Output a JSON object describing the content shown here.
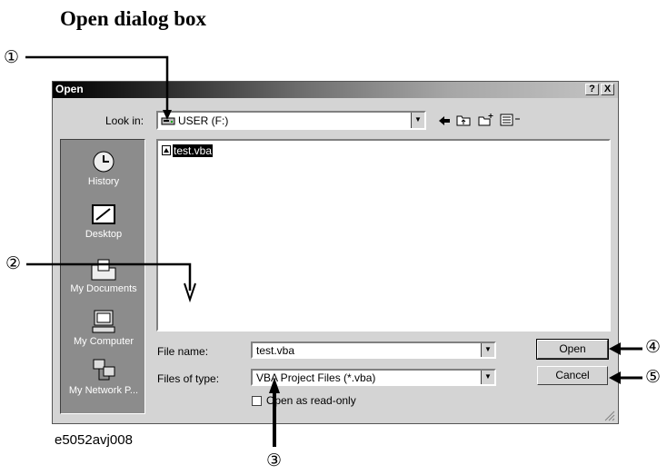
{
  "heading": "Open dialog box",
  "figure_id": "e5052avj008",
  "dialog": {
    "title": "Open",
    "title_buttons": {
      "help": "?",
      "close": "X"
    },
    "look_in_label": "Look in:",
    "look_in_value": "USER (F:)",
    "places": [
      {
        "label": "History",
        "icon": "history-icon"
      },
      {
        "label": "Desktop",
        "icon": "desktop-icon"
      },
      {
        "label": "My Documents",
        "icon": "documents-icon"
      },
      {
        "label": "My Computer",
        "icon": "computer-icon"
      },
      {
        "label": "My Network P...",
        "icon": "network-icon"
      }
    ],
    "files": [
      {
        "name": "test.vba",
        "icon": "file-icon",
        "selected": true
      }
    ],
    "file_name_label": "File name:",
    "file_name_value": "test.vba",
    "file_type_label": "Files of type:",
    "file_type_value": "VBA Project Files (*.vba)",
    "readonly_label": "Open as read-only",
    "readonly_checked": false,
    "open_label": "Open",
    "cancel_label": "Cancel",
    "toolbar_icons": [
      "back-icon",
      "up-folder-icon",
      "new-folder-icon",
      "view-menu-icon"
    ]
  },
  "callouts": [
    "①",
    "②",
    "③",
    "④",
    "⑤"
  ]
}
